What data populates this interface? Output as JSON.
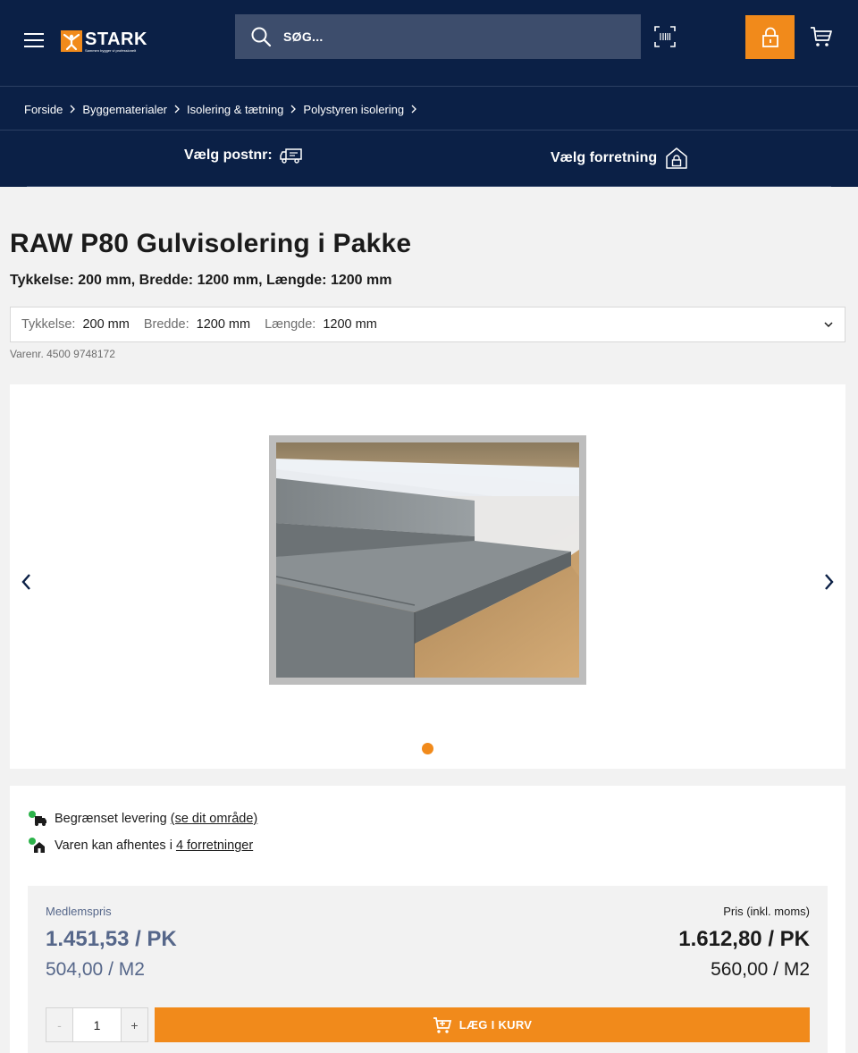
{
  "header": {
    "logo_name": "STARK",
    "logo_tagline": "Sammen bygger vi professionelt",
    "search_placeholder": "SØG...",
    "brand_color": "#f18a1b",
    "nav_color": "#0b2046"
  },
  "breadcrumb": [
    "Forside",
    "Byggematerialer",
    "Isolering & tætning",
    "Polystyren isolering"
  ],
  "store": {
    "postnr_label": "Vælg postnr:",
    "forretning_label": "Vælg forretning"
  },
  "product": {
    "title": "RAW P80 Gulvisolering i Pakke",
    "subtitle": "Tykkelse: 200 mm, Bredde: 1200 mm, Længde: 1200 mm",
    "variant": [
      {
        "label": "Tykkelse:",
        "value": "200 mm"
      },
      {
        "label": "Bredde:",
        "value": "1200 mm"
      },
      {
        "label": "Længde:",
        "value": "1200 mm"
      }
    ],
    "varenr": "Varenr. 4500 9748172"
  },
  "availability": {
    "delivery_text": "Begrænset levering",
    "delivery_link": "(se dit område)",
    "pickup_text": "Varen kan afhentes i",
    "pickup_link": "4 forretninger"
  },
  "price": {
    "member_label": "Medlemspris",
    "member_pk": "1.451,53 / PK",
    "member_m2": "504,00 / M2",
    "regular_label": "Pris (inkl. moms)",
    "regular_pk": "1.612,80 / PK",
    "regular_m2": "560,00 / M2"
  },
  "cart": {
    "minus": "-",
    "plus": "+",
    "quantity": "1",
    "add_label": "LÆG I KURV"
  }
}
